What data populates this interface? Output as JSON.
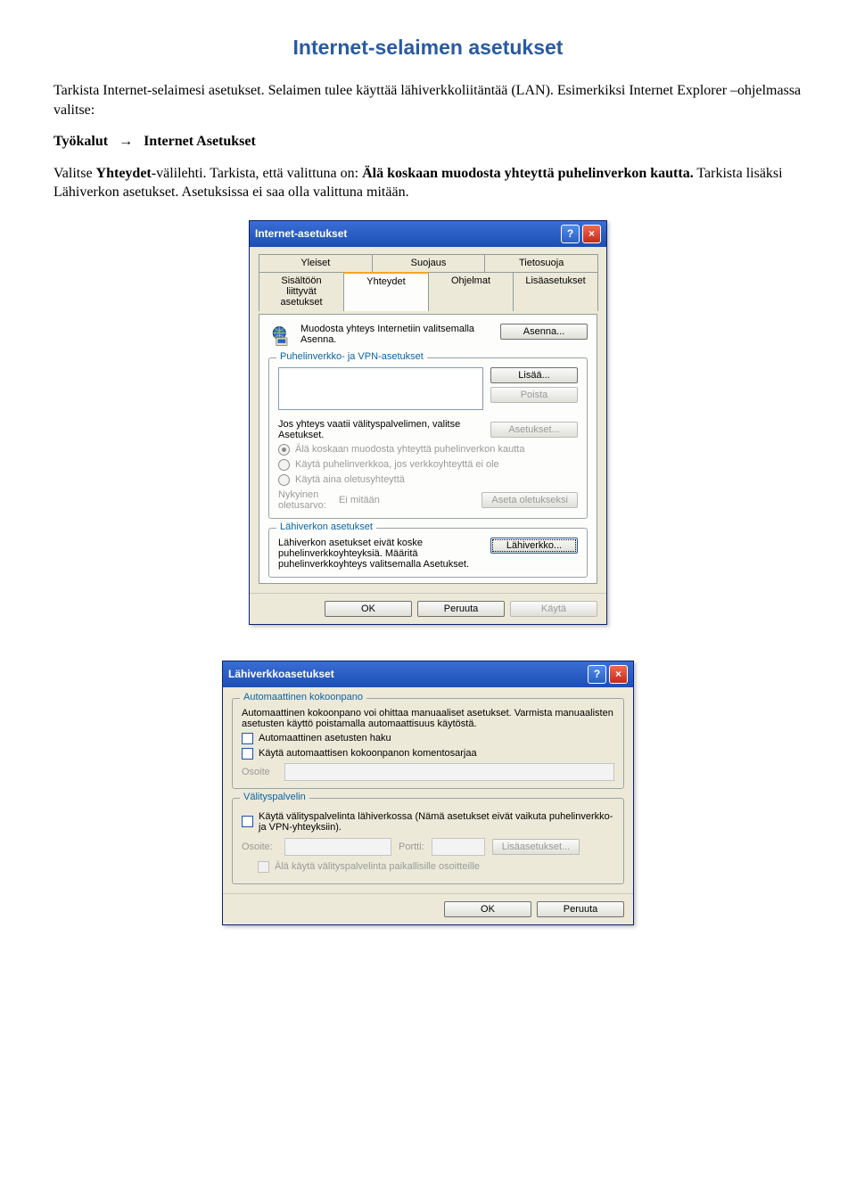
{
  "heading": "Internet-selaimen asetukset",
  "intro": {
    "line1": "Tarkista Internet-selaimesi asetukset. Selaimen tulee käyttää lähiverkkoliitäntää (LAN). Esimerkiksi Internet Explorer –ohjelmassa valitse:",
    "tools": "Työkalut",
    "arrow": "→",
    "internet_settings": "Internet Asetukset",
    "line2a": "Valitse ",
    "line2boldA": "Yhteydet",
    "line2rest": "-välilehti. Tarkista, että valittuna on: ",
    "line2boldB": "Älä koskaan muodosta yhteyttä puhelinverkon kautta.",
    "line2end": " Tarkista lisäksi Lähiverkon asetukset. Asetuksissa ei saa olla valittuna mitään."
  },
  "dlg1": {
    "title": "Internet-asetukset",
    "tabs_row1": [
      "Yleiset",
      "Suojaus",
      "Tietosuoja"
    ],
    "tabs_row2": [
      "Sisältöön liittyvät asetukset",
      "Yhteydet",
      "Ohjelmat",
      "Lisäasetukset"
    ],
    "active_tab": "Yhteydet",
    "connect_text": "Muodosta yhteys Internetiin valitsemalla Asenna.",
    "btn_install": "Asenna...",
    "group_vpn": "Puhelinverkko- ja VPN-asetukset",
    "btn_add": "Lisää...",
    "btn_remove": "Poista",
    "proxy_hint": "Jos yhteys vaatii välityspalvelimen, valitse Asetukset.",
    "btn_settings": "Asetukset...",
    "radio1": "Älä koskaan muodosta yhteyttä puhelinverkon kautta",
    "radio2": "Käytä puhelinverkkoa, jos verkkoyhteyttä ei ole",
    "radio3": "Käytä aina oletusyhteyttä",
    "default_label": "Nykyinen oletusarvo:",
    "default_value": "Ei mitään",
    "btn_default": "Aseta oletukseksi",
    "group_lan": "Lähiverkon asetukset",
    "lan_text": "Lähiverkon asetukset eivät koske puhelinverkkoyhteyksiä. Määritä puhelinverkkoyhteys valitsemalla Asetukset.",
    "btn_lan": "Lähiverkko...",
    "ok": "OK",
    "cancel": "Peruuta",
    "apply": "Käytä"
  },
  "dlg2": {
    "title": "Lähiverkkoasetukset",
    "group_auto": "Automaattinen kokoonpano",
    "auto_text": "Automaattinen kokoonpano voi ohittaa manuaaliset asetukset. Varmista manuaalisten asetusten käyttö poistamalla automaattisuus käytöstä.",
    "chk_auto1": "Automaattinen asetusten haku",
    "chk_auto2": "Käytä automaattisen kokoonpanon komentosarjaa",
    "addr_label": "Osoite",
    "group_proxy": "Välityspalvelin",
    "proxy_text": "Käytä välityspalvelinta lähiverkossa (Nämä asetukset eivät vaikuta puhelinverkko- ja VPN-yhteyksiin).",
    "addr2_label": "Osoite:",
    "port_label": "Portti:",
    "btn_more": "Lisäasetukset...",
    "bypass": "Älä käytä välityspalvelinta paikallisille osoitteille",
    "ok": "OK",
    "cancel": "Peruuta"
  }
}
